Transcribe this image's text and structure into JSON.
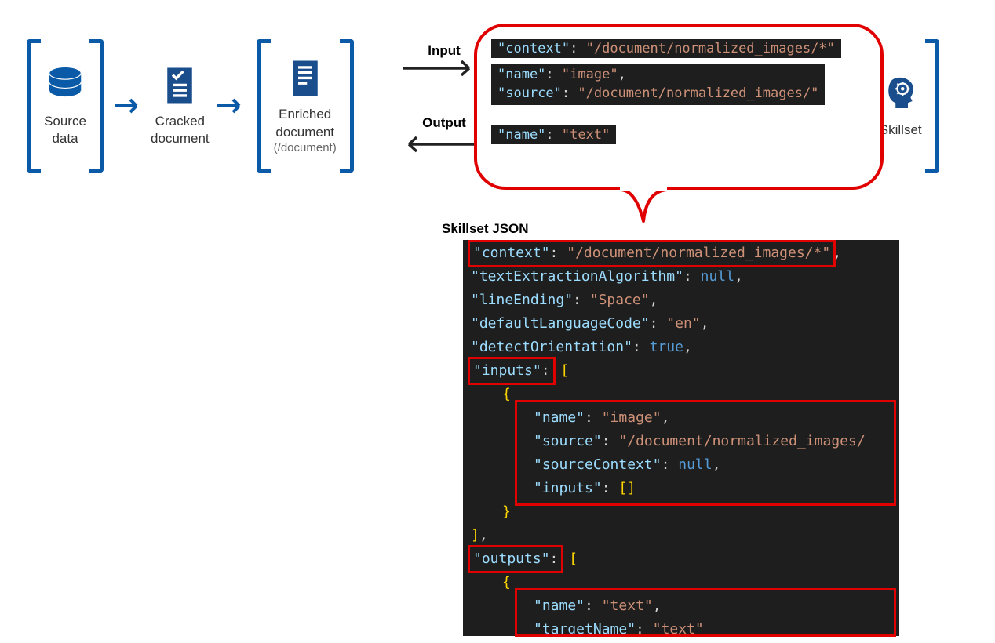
{
  "steps": {
    "source": "Source\ndata",
    "cracked": "Cracked\ndocument",
    "enriched": "Enriched\ndocument",
    "enriched_sub": "(/document)",
    "skillset": "Skillset"
  },
  "io": {
    "input": "Input",
    "output": "Output"
  },
  "bubble": {
    "line1": {
      "k": "\"context\"",
      "v": "\"/document/normalized_images/*\""
    },
    "line2a": {
      "k": "\"name\"",
      "v": "\"image\""
    },
    "line2b": {
      "k": "\"source\"",
      "v": "\"/document/normalized_images/\""
    },
    "line3": {
      "k": "\"name\"",
      "v": "\"text\""
    }
  },
  "json_label": "Skillset JSON",
  "code": {
    "context": {
      "k": "\"context\"",
      "v": "\"/document/normalized_images/*\""
    },
    "tea": {
      "k": "\"textExtractionAlgorithm\"",
      "v": "null"
    },
    "le": {
      "k": "\"lineEnding\"",
      "v": "\"Space\""
    },
    "dlc": {
      "k": "\"defaultLanguageCode\"",
      "v": "\"en\""
    },
    "do": {
      "k": "\"detectOrientation\"",
      "v": "true"
    },
    "inputs_k": "\"inputs\"",
    "in_name": {
      "k": "\"name\"",
      "v": "\"image\""
    },
    "in_source": {
      "k": "\"source\"",
      "v": "\"/document/normalized_images/"
    },
    "in_sc": {
      "k": "\"sourceContext\"",
      "v": "null"
    },
    "in_inputs": {
      "k": "\"inputs\"",
      "v": "[]"
    },
    "outputs_k": "\"outputs\"",
    "out_name": {
      "k": "\"name\"",
      "v": "\"text\""
    },
    "out_tn": {
      "k": "\"targetName\"",
      "v": "\"text\""
    }
  }
}
